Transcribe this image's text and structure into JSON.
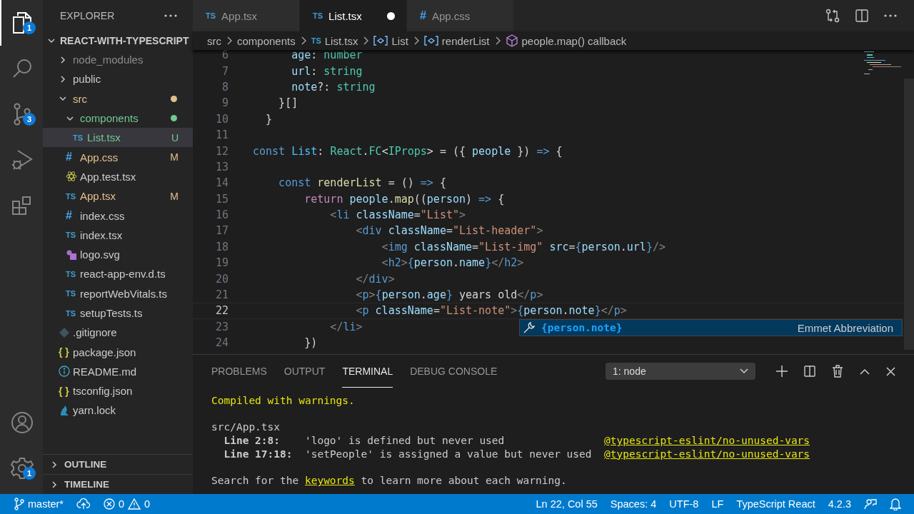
{
  "activity_bar": {
    "items": [
      {
        "kind": "explorer",
        "selected": true,
        "badge": "1"
      },
      {
        "kind": "search",
        "selected": false
      },
      {
        "kind": "source-control",
        "selected": false,
        "badge": "3"
      },
      {
        "kind": "run-debug",
        "selected": false
      },
      {
        "kind": "extensions",
        "selected": false
      }
    ],
    "bottom_items": [
      {
        "kind": "account"
      },
      {
        "kind": "settings",
        "badge": "1"
      }
    ]
  },
  "sidebar": {
    "title": "EXPLORER",
    "project": "REACT-WITH-TYPESCRIPT",
    "project_expanded": true,
    "tree": [
      {
        "name": "node_modules",
        "expanded": false,
        "selected": false,
        "color": "#8c8c8c"
      },
      {
        "name": "public",
        "expanded": false,
        "selected": false,
        "color": "#cccccc"
      },
      {
        "name": "src",
        "expanded": true,
        "selected": false,
        "color": "#e2c08d",
        "children": [
          {
            "name": "components",
            "expanded": true,
            "selected": false,
            "color": "#73c991",
            "children": [
              {
                "name": "List.tsx",
                "icon": {
                  "kind": "ts",
                  "glyph": "TS"
                },
                "selected": true,
                "color": "#73c991",
                "badge": "U"
              }
            ]
          },
          {
            "name": "App.css",
            "icon": {
              "kind": "css",
              "glyph": "#"
            },
            "selected": false,
            "color": "#e2c08d",
            "badge": "M"
          },
          {
            "name": "App.test.tsx",
            "icon": {
              "kind": "react"
            },
            "selected": false,
            "color": "#cccccc"
          },
          {
            "name": "App.tsx",
            "icon": {
              "kind": "ts",
              "glyph": "TS"
            },
            "selected": false,
            "color": "#e2c08d",
            "badge": "M"
          },
          {
            "name": "index.css",
            "icon": {
              "kind": "css",
              "glyph": "#"
            },
            "selected": false,
            "color": "#cccccc"
          },
          {
            "name": "index.tsx",
            "icon": {
              "kind": "ts",
              "glyph": "TS"
            },
            "selected": false,
            "color": "#cccccc"
          },
          {
            "name": "logo.svg",
            "icon": {
              "kind": "svg"
            },
            "selected": false,
            "color": "#cccccc"
          },
          {
            "name": "react-app-env.d.ts",
            "icon": {
              "kind": "ts",
              "glyph": "TS"
            },
            "selected": false,
            "color": "#cccccc"
          },
          {
            "name": "reportWebVitals.ts",
            "icon": {
              "kind": "ts",
              "glyph": "TS"
            },
            "selected": false,
            "color": "#cccccc"
          },
          {
            "name": "setupTests.ts",
            "icon": {
              "kind": "ts",
              "glyph": "TS"
            },
            "selected": false,
            "color": "#cccccc"
          }
        ]
      },
      {
        "name": ".gitignore",
        "icon": {
          "kind": "git"
        },
        "selected": false,
        "color": "#cccccc"
      },
      {
        "name": "package.json",
        "icon": {
          "kind": "json",
          "glyph": "{ }"
        },
        "selected": false,
        "color": "#cccccc"
      },
      {
        "name": "README.md",
        "icon": {
          "kind": "info"
        },
        "selected": false,
        "color": "#cccccc"
      },
      {
        "name": "tsconfig.json",
        "icon": {
          "kind": "json",
          "glyph": "{ }"
        },
        "selected": false,
        "color": "#cccccc"
      },
      {
        "name": "yarn.lock",
        "icon": {
          "kind": "yarn"
        },
        "selected": false,
        "color": "#cccccc"
      }
    ],
    "sections": [
      {
        "label": "OUTLINE",
        "expanded": false
      },
      {
        "label": "TIMELINE",
        "expanded": false
      }
    ]
  },
  "editor": {
    "tabs": [
      {
        "label": "App.tsx",
        "icon": {
          "kind": "ts",
          "glyph": "TS"
        },
        "selected": false,
        "dirty": false
      },
      {
        "label": "List.tsx",
        "icon": {
          "kind": "ts",
          "glyph": "TS"
        },
        "selected": true,
        "dirty": true
      },
      {
        "label": "App.css",
        "icon": {
          "kind": "css",
          "glyph": "#"
        },
        "selected": false,
        "dirty": false
      }
    ],
    "breadcrumbs": [
      {
        "label": "src",
        "kind": "folder"
      },
      {
        "label": "components",
        "kind": "folder"
      },
      {
        "label": "List.tsx",
        "kind": "file",
        "icon": {
          "kind": "ts",
          "glyph": "TS"
        }
      },
      {
        "label": "List",
        "kind": "variable"
      },
      {
        "label": "renderList",
        "kind": "variable"
      },
      {
        "label": "people.map() callback",
        "kind": "method"
      }
    ],
    "lines": [
      {
        "number": "6",
        "current": false,
        "tokens": [
          {
            "text": "      age",
            "kind": "variable"
          },
          {
            "text": ": ",
            "kind": "punctuation"
          },
          {
            "text": "number",
            "kind": "type"
          }
        ]
      },
      {
        "number": "7",
        "current": false,
        "tokens": [
          {
            "text": "      url",
            "kind": "variable"
          },
          {
            "text": ": ",
            "kind": "punctuation"
          },
          {
            "text": "string",
            "kind": "type"
          }
        ]
      },
      {
        "number": "8",
        "current": false,
        "tokens": [
          {
            "text": "      note",
            "kind": "variable"
          },
          {
            "text": "?: ",
            "kind": "punctuation"
          },
          {
            "text": "string",
            "kind": "type"
          }
        ]
      },
      {
        "number": "9",
        "current": false,
        "tokens": [
          {
            "text": "    }[]",
            "kind": "punctuation"
          }
        ]
      },
      {
        "number": "10",
        "current": false,
        "tokens": [
          {
            "text": "  }",
            "kind": "punctuation"
          }
        ]
      },
      {
        "number": "11",
        "current": false
      },
      {
        "number": "12",
        "current": false,
        "tokens": [
          {
            "text": "const",
            "kind": "keyword"
          },
          {
            "text": " List",
            "kind": "constant"
          },
          {
            "text": ": ",
            "kind": "punctuation"
          },
          {
            "text": "React",
            "kind": "type"
          },
          {
            "text": ".",
            "kind": "punctuation"
          },
          {
            "text": "FC",
            "kind": "type"
          },
          {
            "text": "<",
            "kind": "punctuation"
          },
          {
            "text": "IProps",
            "kind": "type"
          },
          {
            "text": "> = ({ ",
            "kind": "punctuation"
          },
          {
            "text": "people",
            "kind": "variable"
          },
          {
            "text": " }) ",
            "kind": "punctuation"
          },
          {
            "text": "=>",
            "kind": "keyword"
          },
          {
            "text": " {",
            "kind": "punctuation"
          }
        ]
      },
      {
        "number": "13",
        "current": false
      },
      {
        "number": "14",
        "current": false,
        "tokens": [
          {
            "text": "    const",
            "kind": "keyword"
          },
          {
            "text": " renderList",
            "kind": "function"
          },
          {
            "text": " = () ",
            "kind": "punctuation"
          },
          {
            "text": "=>",
            "kind": "keyword"
          },
          {
            "text": " {",
            "kind": "punctuation"
          }
        ]
      },
      {
        "number": "15",
        "current": false,
        "tokens": [
          {
            "text": "        return",
            "kind": "control"
          },
          {
            "text": " people",
            "kind": "variable"
          },
          {
            "text": ".",
            "kind": "punctuation"
          },
          {
            "text": "map",
            "kind": "function"
          },
          {
            "text": "((",
            "kind": "punctuation"
          },
          {
            "text": "person",
            "kind": "variable"
          },
          {
            "text": ") ",
            "kind": "punctuation"
          },
          {
            "text": "=>",
            "kind": "keyword"
          },
          {
            "text": " {",
            "kind": "punctuation"
          }
        ]
      },
      {
        "number": "16",
        "current": false,
        "tokens": [
          {
            "text": "            <",
            "kind": "bracket"
          },
          {
            "text": "li",
            "kind": "tag"
          },
          {
            "text": " className",
            "kind": "attribute"
          },
          {
            "text": "=",
            "kind": "punctuation"
          },
          {
            "text": "\"List\"",
            "kind": "string"
          },
          {
            "text": ">",
            "kind": "bracket"
          }
        ]
      },
      {
        "number": "17",
        "current": false,
        "tokens": [
          {
            "text": "                <",
            "kind": "bracket"
          },
          {
            "text": "div",
            "kind": "tag"
          },
          {
            "text": " className",
            "kind": "attribute"
          },
          {
            "text": "=",
            "kind": "punctuation"
          },
          {
            "text": "\"List-header\"",
            "kind": "string"
          },
          {
            "text": ">",
            "kind": "bracket"
          }
        ]
      },
      {
        "number": "18",
        "current": false,
        "tokens": [
          {
            "text": "                    <",
            "kind": "bracket"
          },
          {
            "text": "img",
            "kind": "tag"
          },
          {
            "text": " className",
            "kind": "attribute"
          },
          {
            "text": "=",
            "kind": "punctuation"
          },
          {
            "text": "\"List-img\"",
            "kind": "string"
          },
          {
            "text": " src",
            "kind": "attribute"
          },
          {
            "text": "=",
            "kind": "punctuation"
          },
          {
            "text": "{",
            "kind": "brace"
          },
          {
            "text": "person",
            "kind": "variable"
          },
          {
            "text": ".",
            "kind": "punctuation"
          },
          {
            "text": "url",
            "kind": "variable"
          },
          {
            "text": "}",
            "kind": "brace"
          },
          {
            "text": "/>",
            "kind": "bracket"
          }
        ]
      },
      {
        "number": "19",
        "current": false,
        "tokens": [
          {
            "text": "                    <",
            "kind": "bracket"
          },
          {
            "text": "h2",
            "kind": "tag"
          },
          {
            "text": ">",
            "kind": "bracket"
          },
          {
            "text": "{",
            "kind": "brace"
          },
          {
            "text": "person",
            "kind": "variable"
          },
          {
            "text": ".",
            "kind": "punctuation"
          },
          {
            "text": "name",
            "kind": "variable"
          },
          {
            "text": "}",
            "kind": "brace"
          },
          {
            "text": "</",
            "kind": "bracket"
          },
          {
            "text": "h2",
            "kind": "tag"
          },
          {
            "text": ">",
            "kind": "bracket"
          }
        ]
      },
      {
        "number": "20",
        "current": false,
        "tokens": [
          {
            "text": "                </",
            "kind": "bracket"
          },
          {
            "text": "div",
            "kind": "tag"
          },
          {
            "text": ">",
            "kind": "bracket"
          }
        ]
      },
      {
        "number": "21",
        "current": false,
        "tokens": [
          {
            "text": "                <",
            "kind": "bracket"
          },
          {
            "text": "p",
            "kind": "tag"
          },
          {
            "text": ">",
            "kind": "bracket"
          },
          {
            "text": "{",
            "kind": "brace"
          },
          {
            "text": "person",
            "kind": "variable"
          },
          {
            "text": ".",
            "kind": "punctuation"
          },
          {
            "text": "age",
            "kind": "variable"
          },
          {
            "text": "}",
            "kind": "brace"
          },
          {
            "text": " years old",
            "kind": "text"
          },
          {
            "text": "</",
            "kind": "bracket"
          },
          {
            "text": "p",
            "kind": "tag"
          },
          {
            "text": ">",
            "kind": "bracket"
          }
        ]
      },
      {
        "number": "22",
        "current": true,
        "tokens": [
          {
            "text": "                <",
            "kind": "bracket"
          },
          {
            "text": "p",
            "kind": "tag"
          },
          {
            "text": " className",
            "kind": "attribute"
          },
          {
            "text": "=",
            "kind": "punctuation"
          },
          {
            "text": "\"List-note\"",
            "kind": "string"
          },
          {
            "text": ">",
            "kind": "bracket"
          },
          {
            "text": "{",
            "kind": "brace"
          },
          {
            "text": "person",
            "kind": "variable"
          },
          {
            "text": ".",
            "kind": "punctuation"
          },
          {
            "text": "note",
            "kind": "variable"
          },
          {
            "text": "}",
            "kind": "brace"
          },
          {
            "text": "</",
            "kind": "bracket"
          },
          {
            "text": "p",
            "kind": "tag"
          },
          {
            "text": ">",
            "kind": "bracket"
          }
        ]
      },
      {
        "number": "23",
        "current": false,
        "tokens": [
          {
            "text": "            </",
            "kind": "bracket"
          },
          {
            "text": "li",
            "kind": "tag"
          },
          {
            "text": ">",
            "kind": "bracket"
          }
        ]
      },
      {
        "number": "24",
        "current": false,
        "tokens": [
          {
            "text": "        })",
            "kind": "punctuation"
          }
        ]
      }
    ],
    "suggestion": {
      "label": "{person.note}",
      "detail": "Emmet Abbreviation"
    }
  },
  "panel": {
    "tabs": [
      {
        "label": "PROBLEMS",
        "selected": false
      },
      {
        "label": "OUTPUT",
        "selected": false
      },
      {
        "label": "TERMINAL",
        "selected": true
      },
      {
        "label": "DEBUG CONSOLE",
        "selected": false
      }
    ],
    "terminal_select": "1: node",
    "terminal": [
      {
        "kind": "text",
        "segments": [
          {
            "text": "Compiled with warnings.",
            "kind": "warning"
          }
        ]
      },
      {
        "kind": "blank"
      },
      {
        "kind": "text",
        "segments": [
          {
            "text": "src/App.tsx",
            "kind": "plain"
          }
        ]
      },
      {
        "kind": "text",
        "segments": [
          {
            "text": "  Line 2:8:",
            "kind": "bold"
          },
          {
            "text": "    'logo' is defined but never used                ",
            "kind": "plain"
          },
          {
            "text": "@typescript-eslint/no-unused-vars",
            "kind": "link"
          }
        ]
      },
      {
        "kind": "text",
        "segments": [
          {
            "text": "  Line 17:18:",
            "kind": "bold"
          },
          {
            "text": "  'setPeople' is assigned a value but never used  ",
            "kind": "plain"
          },
          {
            "text": "@typescript-eslint/no-unused-vars",
            "kind": "link"
          }
        ]
      },
      {
        "kind": "blank"
      },
      {
        "kind": "text",
        "segments": [
          {
            "text": "Search for the ",
            "kind": "plain"
          },
          {
            "text": "keywords",
            "kind": "link"
          },
          {
            "text": " to learn more about each warning.",
            "kind": "plain"
          }
        ]
      }
    ]
  },
  "status_bar": {
    "branch": "master*",
    "errors": "0",
    "warnings": "0",
    "items": [
      "Ln 22, Col 55",
      "Spaces: 4",
      "UTF-8",
      "LF",
      "TypeScript React",
      "4.2.3"
    ]
  }
}
